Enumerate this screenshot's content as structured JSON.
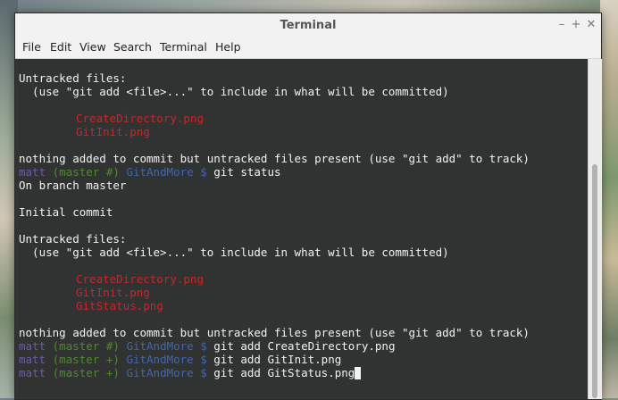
{
  "window": {
    "title": "Terminal"
  },
  "menu": [
    "File",
    "Edit",
    "View",
    "Search",
    "Terminal",
    "Help"
  ],
  "terminal": {
    "untracked_header": "Untracked files:",
    "hint": "  (use \"git add <file>...\" to include in what will be committed)",
    "block1_files": [
      "CreateDirectory.png",
      "GitInit.png"
    ],
    "nothing_msg": "nothing added to commit but untracked files present (use \"git add\" to track)",
    "prompt_user": "matt",
    "prompt_branch_hash": "(master #)",
    "prompt_branch_plus": "(master +)",
    "prompt_dir": "GitAndMore $",
    "cmd_status": " git status",
    "on_branch": "On branch master",
    "initial_commit": "Initial commit",
    "block2_files": [
      "CreateDirectory.png",
      "GitInit.png",
      "GitStatus.png"
    ],
    "cmd_add1": " git add CreateDirectory.png",
    "cmd_add2": " git add GitInit.png",
    "cmd_add3": " git add GitStatus.png"
  }
}
